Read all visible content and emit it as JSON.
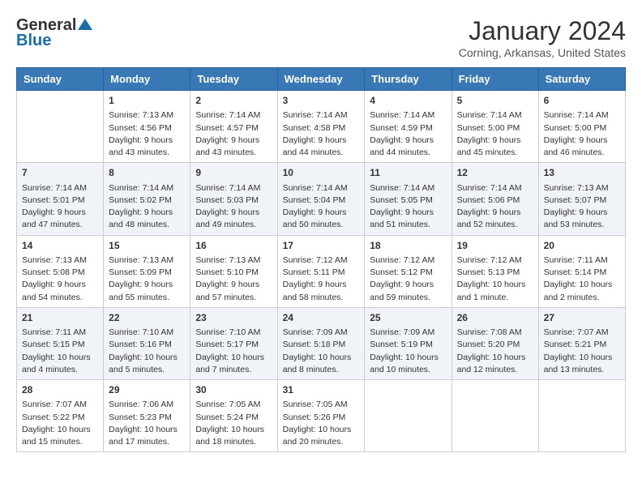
{
  "header": {
    "logo_general": "General",
    "logo_blue": "Blue",
    "month_year": "January 2024",
    "location": "Corning, Arkansas, United States"
  },
  "days_of_week": [
    "Sunday",
    "Monday",
    "Tuesday",
    "Wednesday",
    "Thursday",
    "Friday",
    "Saturday"
  ],
  "weeks": [
    [
      {
        "day": "",
        "sunrise": "",
        "sunset": "",
        "daylight": ""
      },
      {
        "day": "1",
        "sunrise": "Sunrise: 7:13 AM",
        "sunset": "Sunset: 4:56 PM",
        "daylight": "Daylight: 9 hours and 43 minutes."
      },
      {
        "day": "2",
        "sunrise": "Sunrise: 7:14 AM",
        "sunset": "Sunset: 4:57 PM",
        "daylight": "Daylight: 9 hours and 43 minutes."
      },
      {
        "day": "3",
        "sunrise": "Sunrise: 7:14 AM",
        "sunset": "Sunset: 4:58 PM",
        "daylight": "Daylight: 9 hours and 44 minutes."
      },
      {
        "day": "4",
        "sunrise": "Sunrise: 7:14 AM",
        "sunset": "Sunset: 4:59 PM",
        "daylight": "Daylight: 9 hours and 44 minutes."
      },
      {
        "day": "5",
        "sunrise": "Sunrise: 7:14 AM",
        "sunset": "Sunset: 5:00 PM",
        "daylight": "Daylight: 9 hours and 45 minutes."
      },
      {
        "day": "6",
        "sunrise": "Sunrise: 7:14 AM",
        "sunset": "Sunset: 5:00 PM",
        "daylight": "Daylight: 9 hours and 46 minutes."
      }
    ],
    [
      {
        "day": "7",
        "sunrise": "Sunrise: 7:14 AM",
        "sunset": "Sunset: 5:01 PM",
        "daylight": "Daylight: 9 hours and 47 minutes."
      },
      {
        "day": "8",
        "sunrise": "Sunrise: 7:14 AM",
        "sunset": "Sunset: 5:02 PM",
        "daylight": "Daylight: 9 hours and 48 minutes."
      },
      {
        "day": "9",
        "sunrise": "Sunrise: 7:14 AM",
        "sunset": "Sunset: 5:03 PM",
        "daylight": "Daylight: 9 hours and 49 minutes."
      },
      {
        "day": "10",
        "sunrise": "Sunrise: 7:14 AM",
        "sunset": "Sunset: 5:04 PM",
        "daylight": "Daylight: 9 hours and 50 minutes."
      },
      {
        "day": "11",
        "sunrise": "Sunrise: 7:14 AM",
        "sunset": "Sunset: 5:05 PM",
        "daylight": "Daylight: 9 hours and 51 minutes."
      },
      {
        "day": "12",
        "sunrise": "Sunrise: 7:14 AM",
        "sunset": "Sunset: 5:06 PM",
        "daylight": "Daylight: 9 hours and 52 minutes."
      },
      {
        "day": "13",
        "sunrise": "Sunrise: 7:13 AM",
        "sunset": "Sunset: 5:07 PM",
        "daylight": "Daylight: 9 hours and 53 minutes."
      }
    ],
    [
      {
        "day": "14",
        "sunrise": "Sunrise: 7:13 AM",
        "sunset": "Sunset: 5:08 PM",
        "daylight": "Daylight: 9 hours and 54 minutes."
      },
      {
        "day": "15",
        "sunrise": "Sunrise: 7:13 AM",
        "sunset": "Sunset: 5:09 PM",
        "daylight": "Daylight: 9 hours and 55 minutes."
      },
      {
        "day": "16",
        "sunrise": "Sunrise: 7:13 AM",
        "sunset": "Sunset: 5:10 PM",
        "daylight": "Daylight: 9 hours and 57 minutes."
      },
      {
        "day": "17",
        "sunrise": "Sunrise: 7:12 AM",
        "sunset": "Sunset: 5:11 PM",
        "daylight": "Daylight: 9 hours and 58 minutes."
      },
      {
        "day": "18",
        "sunrise": "Sunrise: 7:12 AM",
        "sunset": "Sunset: 5:12 PM",
        "daylight": "Daylight: 9 hours and 59 minutes."
      },
      {
        "day": "19",
        "sunrise": "Sunrise: 7:12 AM",
        "sunset": "Sunset: 5:13 PM",
        "daylight": "Daylight: 10 hours and 1 minute."
      },
      {
        "day": "20",
        "sunrise": "Sunrise: 7:11 AM",
        "sunset": "Sunset: 5:14 PM",
        "daylight": "Daylight: 10 hours and 2 minutes."
      }
    ],
    [
      {
        "day": "21",
        "sunrise": "Sunrise: 7:11 AM",
        "sunset": "Sunset: 5:15 PM",
        "daylight": "Daylight: 10 hours and 4 minutes."
      },
      {
        "day": "22",
        "sunrise": "Sunrise: 7:10 AM",
        "sunset": "Sunset: 5:16 PM",
        "daylight": "Daylight: 10 hours and 5 minutes."
      },
      {
        "day": "23",
        "sunrise": "Sunrise: 7:10 AM",
        "sunset": "Sunset: 5:17 PM",
        "daylight": "Daylight: 10 hours and 7 minutes."
      },
      {
        "day": "24",
        "sunrise": "Sunrise: 7:09 AM",
        "sunset": "Sunset: 5:18 PM",
        "daylight": "Daylight: 10 hours and 8 minutes."
      },
      {
        "day": "25",
        "sunrise": "Sunrise: 7:09 AM",
        "sunset": "Sunset: 5:19 PM",
        "daylight": "Daylight: 10 hours and 10 minutes."
      },
      {
        "day": "26",
        "sunrise": "Sunrise: 7:08 AM",
        "sunset": "Sunset: 5:20 PM",
        "daylight": "Daylight: 10 hours and 12 minutes."
      },
      {
        "day": "27",
        "sunrise": "Sunrise: 7:07 AM",
        "sunset": "Sunset: 5:21 PM",
        "daylight": "Daylight: 10 hours and 13 minutes."
      }
    ],
    [
      {
        "day": "28",
        "sunrise": "Sunrise: 7:07 AM",
        "sunset": "Sunset: 5:22 PM",
        "daylight": "Daylight: 10 hours and 15 minutes."
      },
      {
        "day": "29",
        "sunrise": "Sunrise: 7:06 AM",
        "sunset": "Sunset: 5:23 PM",
        "daylight": "Daylight: 10 hours and 17 minutes."
      },
      {
        "day": "30",
        "sunrise": "Sunrise: 7:05 AM",
        "sunset": "Sunset: 5:24 PM",
        "daylight": "Daylight: 10 hours and 18 minutes."
      },
      {
        "day": "31",
        "sunrise": "Sunrise: 7:05 AM",
        "sunset": "Sunset: 5:26 PM",
        "daylight": "Daylight: 10 hours and 20 minutes."
      },
      {
        "day": "",
        "sunrise": "",
        "sunset": "",
        "daylight": ""
      },
      {
        "day": "",
        "sunrise": "",
        "sunset": "",
        "daylight": ""
      },
      {
        "day": "",
        "sunrise": "",
        "sunset": "",
        "daylight": ""
      }
    ]
  ]
}
